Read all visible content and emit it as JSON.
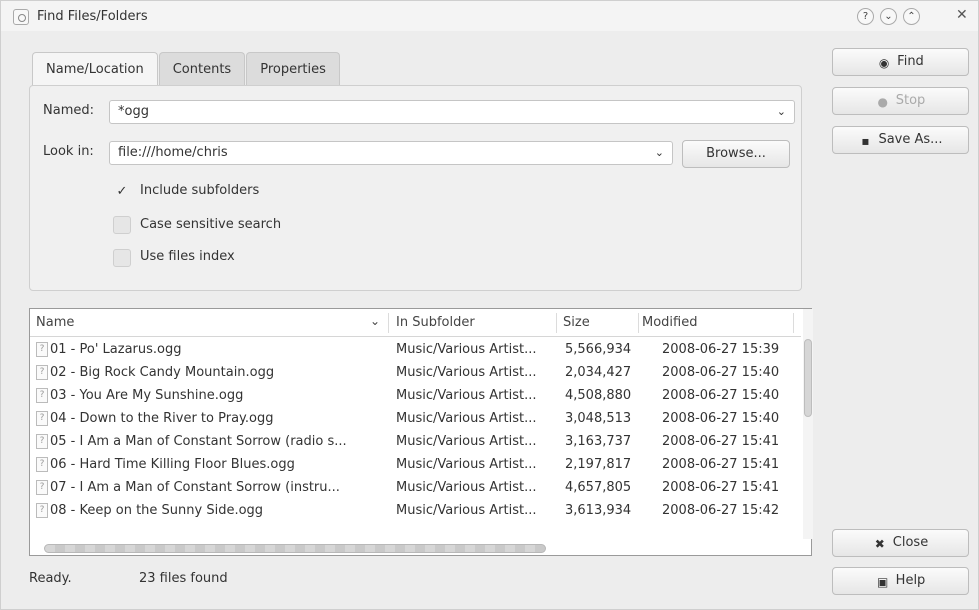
{
  "window": {
    "title": "Find Files/Folders",
    "help_label": "?",
    "minimize_label": "⌄",
    "maximize_label": "⌃",
    "close_label": "✕"
  },
  "tabs": [
    {
      "label": "Name/Location"
    },
    {
      "label": "Contents"
    },
    {
      "label": "Properties"
    }
  ],
  "form": {
    "named_label": "Named:",
    "named_value": "*ogg",
    "look_in_label": "Look in:",
    "look_in_value": "file:///home/chris",
    "browse_label": "Browse...",
    "include_subfolders_label": "Include subfolders",
    "include_subfolders_checked": true,
    "case_sensitive_label": "Case sensitive search",
    "case_sensitive_checked": false,
    "use_index_label": "Use files index",
    "use_index_checked": false,
    "checkmark": "✓",
    "dropdown_arrow": "⌄"
  },
  "buttons": {
    "find_label": "Find",
    "stop_label": "Stop",
    "save_as_label": "Save As...",
    "close_label": "Close",
    "help_label": "Help"
  },
  "results": {
    "columns": [
      {
        "label": "Name"
      },
      {
        "label": "In Subfolder"
      },
      {
        "label": "Size"
      },
      {
        "label": "Modified"
      }
    ],
    "sort_indicator": "⌄",
    "rows": [
      {
        "name": "01 - Po' Lazarus.ogg",
        "folder": "Music/Various Artist...",
        "size": "5,566,934",
        "modified": "2008-06-27 15:39"
      },
      {
        "name": "02 - Big Rock Candy Mountain.ogg",
        "folder": "Music/Various Artist...",
        "size": "2,034,427",
        "modified": "2008-06-27 15:40"
      },
      {
        "name": "03 - You Are My Sunshine.ogg",
        "folder": "Music/Various Artist...",
        "size": "4,508,880",
        "modified": "2008-06-27 15:40"
      },
      {
        "name": "04 - Down to the River to Pray.ogg",
        "folder": "Music/Various Artist...",
        "size": "3,048,513",
        "modified": "2008-06-27 15:40"
      },
      {
        "name": "05 - I Am a Man of Constant Sorrow (radio s...",
        "folder": "Music/Various Artist...",
        "size": "3,163,737",
        "modified": "2008-06-27 15:41"
      },
      {
        "name": "06 - Hard Time Killing Floor Blues.ogg",
        "folder": "Music/Various Artist...",
        "size": "2,197,817",
        "modified": "2008-06-27 15:41"
      },
      {
        "name": "07 - I Am a Man of Constant Sorrow (instru...",
        "folder": "Music/Various Artist...",
        "size": "4,657,805",
        "modified": "2008-06-27 15:41"
      },
      {
        "name": "08 - Keep on the Sunny Side.ogg",
        "folder": "Music/Various Artist...",
        "size": "3,613,934",
        "modified": "2008-06-27 15:42"
      }
    ]
  },
  "status": {
    "state": "Ready.",
    "count": "23 files found"
  },
  "icons": {
    "app": "find-files-icon",
    "find": "binoculars-icon",
    "stop": "stop-icon",
    "save": "save-icon",
    "close": "close-icon",
    "help": "help-book-icon",
    "file": "unknown-file-icon"
  }
}
